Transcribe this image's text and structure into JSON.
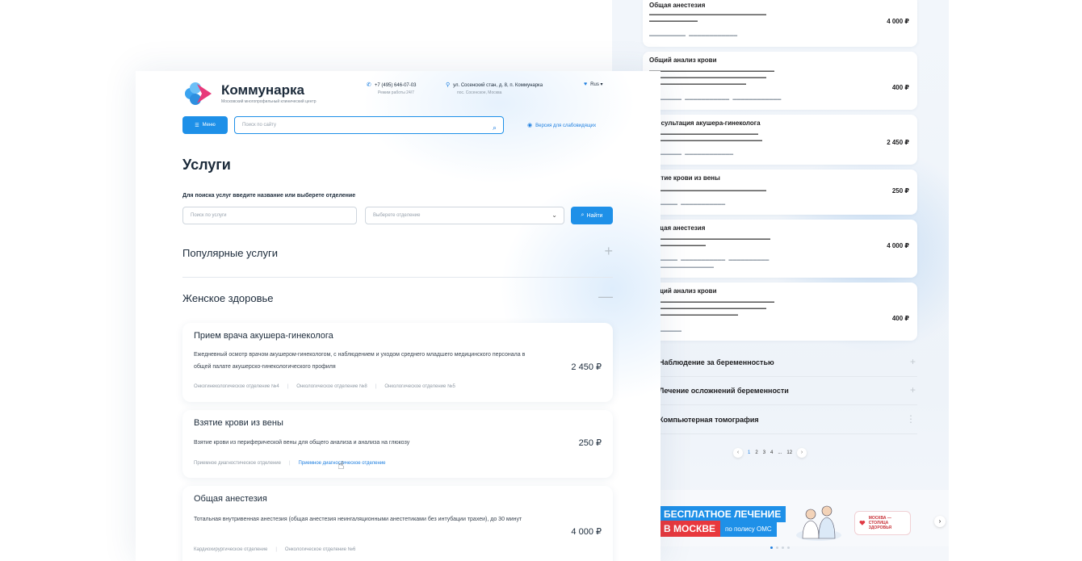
{
  "header": {
    "brand_name": "Коммунарка",
    "brand_subtitle": "Московский многопрофильный клинический центр",
    "phone": "+7 (495) 646-07-03",
    "phone_hours": "Режим работы 24/7",
    "address": "ул. Сосенский стан, д. 8, п. Коммунарка",
    "address_city": "пос. Сосенское, Москва",
    "language": "Rus",
    "menu_label": "Меню",
    "search_placeholder": "Поиск по сайту",
    "vision_label": "Версия для слабовидящих"
  },
  "page": {
    "title": "Услуги",
    "hint": "Для поиска услуг введите название или выберете отделение",
    "service_placeholder": "Поиск по услуги",
    "department_placeholder": "Выберете отделение",
    "find_label": "Найти"
  },
  "accordions": [
    {
      "title": "Популярные услуги",
      "state": "+"
    },
    {
      "title": "Женское здоровье",
      "state": "—"
    }
  ],
  "cards": [
    {
      "title": "Прием врача акушера-гинеколога",
      "description": "Ежедневный осмотр врачом акушером-гинекологом, с наблюдением и уходом среднего младшего медицинского персонала в общей палате акушерско-гинекологического профиля",
      "price": "2 450 ₽",
      "tags": [
        "Онкогинекологическое отделение №4",
        "Онкологическое отделение №8",
        "Онкологическое отделение №5"
      ]
    },
    {
      "title": "Взятие крови из вены",
      "description": "Взятие крови из периферической вены для общего анализа и анализа на глюкозу",
      "price": "250 ₽",
      "tags": [
        "Приемное диагностическое отделение",
        "Приемное диагностическое отделение"
      ]
    },
    {
      "title": "Общая анестезия",
      "description": "Тотальная внутривенная анестезия (общая анестезия неингаляционными анестетиками без интубации трахеи), до 30 минут",
      "price": "4 000 ₽",
      "tags": [
        "Кардиохирургическое отделение",
        "Онкологическое отделение №6"
      ]
    }
  ],
  "back_panel": {
    "cards": [
      {
        "title": "Общая анестезия",
        "price": "4 000 ₽"
      },
      {
        "title": "Общий анализ крови",
        "price": "400 ₽"
      },
      {
        "title": "Консультация акушера-гинеколога",
        "price": "2 450 ₽"
      },
      {
        "title": "Взятие крови из вены",
        "price": "250 ₽"
      },
      {
        "title": "Общая анестезия",
        "price": "4 000 ₽"
      },
      {
        "title": "Общий анализ крови",
        "price": "400 ₽"
      }
    ],
    "accordions": [
      "Наблюдение за беременностью",
      "Лечение осложнений беременности",
      "Компьютерная томография"
    ],
    "pagination": [
      "1",
      "2",
      "3",
      "4",
      "...",
      "12"
    ],
    "banner": {
      "line1": "БЕСПЛАТНОЕ ЛЕЧЕНИЕ",
      "line2a": "В МОСКВЕ",
      "line2b": "по полису ОМС",
      "logo_text": "МОСКВА — СТОЛИЦА ЗДОРОВЬЯ"
    }
  },
  "colors": {
    "accent": "#1e90e8",
    "brand_pink": "#e8397a",
    "brand_blue": "#3aa3f0"
  }
}
